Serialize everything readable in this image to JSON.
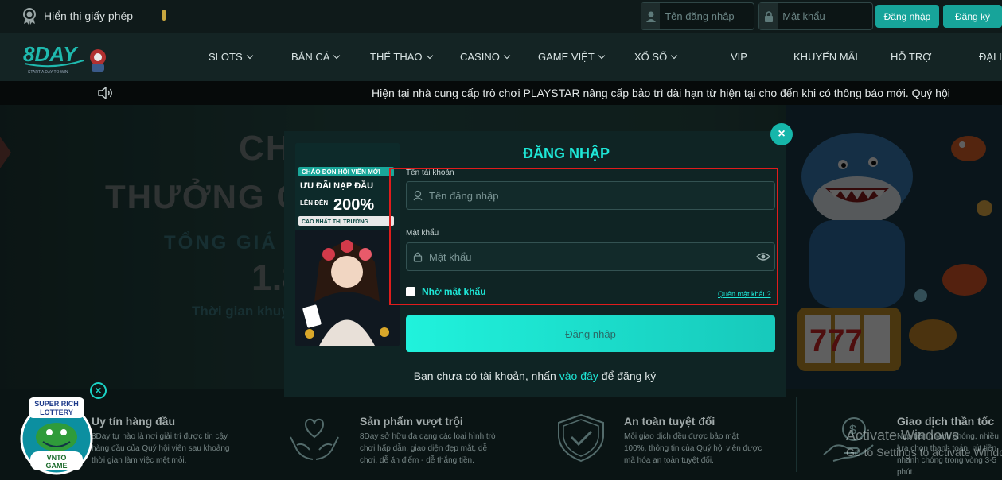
{
  "topbar": {
    "license_text": "Hiển thị giấy phép",
    "username_placeholder": "Tên đăng nhập",
    "password_placeholder": "Mật khẩu",
    "login_button": "Đăng nhập",
    "register_button": "Đăng ký"
  },
  "nav": {
    "items": [
      {
        "label": "SLOTS",
        "dropdown": true
      },
      {
        "label": "BẮN CÁ",
        "dropdown": true
      },
      {
        "label": "THỂ THAO",
        "dropdown": true
      },
      {
        "label": "CASINO",
        "dropdown": true
      },
      {
        "label": "GAME VIỆT",
        "dropdown": true
      },
      {
        "label": "XỔ SỐ",
        "dropdown": true
      },
      {
        "label": "VIP",
        "dropdown": false
      },
      {
        "label": "KHUYẾN MÃI",
        "dropdown": false
      },
      {
        "label": "HỖ TRỢ",
        "dropdown": false
      },
      {
        "label": "ĐẠI L",
        "dropdown": false
      }
    ]
  },
  "marquee": {
    "text": "Hiện tại nhà cung cấp trò chơi PLAYSTAR nâng cấp bảo trì dài hạn từ hiện tại cho đến khi có thông báo mới. Quý hội"
  },
  "hero": {
    "line1": "CH",
    "line2": "THƯỞNG C",
    "line3": "TỔNG GIÁ T",
    "line4": "1.8",
    "line5": "Thời gian khuy"
  },
  "modal": {
    "title": "ĐĂNG NHẬP",
    "username_label": "Tên tài khoản",
    "username_placeholder": "Tên đăng nhập",
    "password_label": "Mật khẩu",
    "password_placeholder": "Mật khẩu",
    "remember_label": "Nhớ mật khẩu",
    "forgot_link": "Quên mật khẩu?",
    "submit_label": "Đăng nhập",
    "register_prefix": "Bạn chưa có tài khoản, nhấn",
    "register_link": "vào đây",
    "register_suffix": "để đăng ký",
    "close_symbol": "×"
  },
  "banner": {
    "line1": "CHÀO ĐÓN HỘI VIÊN MỚI",
    "line2": "ƯU ĐÃI NẠP ĐẦU",
    "line3": "LÊN ĐẾN",
    "line4": "200%",
    "line5": "CAO NHẤT THỊ TRƯỜNG"
  },
  "features": [
    {
      "title": "Uy tín hàng đầu",
      "desc": "8Day tự hào là nơi giải trí được tin cậy hàng đầu của Quý hội viên sau khoảng thời gian làm việc mệt mỏi.",
      "icon": "medal-icon"
    },
    {
      "title": "Sản phẩm vượt trội",
      "desc": "8Day sở hữu đa dạng các loại hình trò chơi hấp dẫn, giao diện đẹp mắt, dễ chơi, dễ ăn điểm - dễ thắng tiền.",
      "icon": "heart-hands-icon"
    },
    {
      "title": "An toàn tuyệt đối",
      "desc": "Mỗi giao dịch đều được bảo mật 100%, thông tin của Quý hội viên được mã hóa an toàn tuyệt đối.",
      "icon": "shield-check-icon"
    },
    {
      "title": "Giao dịch thần tốc",
      "desc": "Nạp tiền nhanh chóng, nhiều lựa chọn thanh toán, rút tiền nhanh chóng trong vòng 3-5 phút.",
      "icon": "money-hand-icon"
    }
  ],
  "lottery": {
    "line1": "SUPER RICH",
    "line2": "LOTTERY",
    "line3": "VNTO",
    "line4": "GAME",
    "close_symbol": "×"
  },
  "watermark": {
    "line1": "Activate Windows",
    "line2": "Go to Settings to activate Windows."
  },
  "colors": {
    "accent": "#1ee6d6",
    "button": "#17a49a",
    "highlight": "#e01c1c"
  }
}
